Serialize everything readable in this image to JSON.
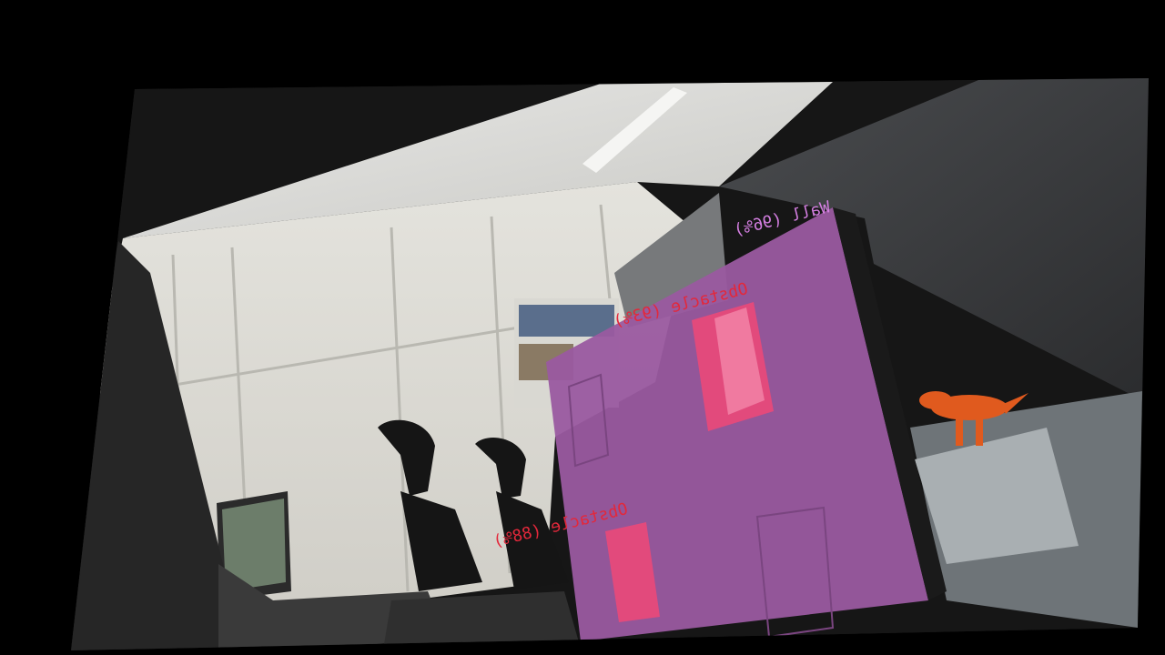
{
  "detections": [
    {
      "id": "wall",
      "text": "Wall (96%)",
      "color": "#d37ee0"
    },
    {
      "id": "obstacle_top",
      "text": "Obstacle (93%)",
      "color": "#e3283b"
    },
    {
      "id": "obstacle_bottom",
      "text": "Obstacle (88%)",
      "color": "#e3283b"
    }
  ],
  "colors": {
    "wall_overlay": "#9a5aa0",
    "obstacle_overlay": "#e64a7a",
    "background": "#000000"
  }
}
